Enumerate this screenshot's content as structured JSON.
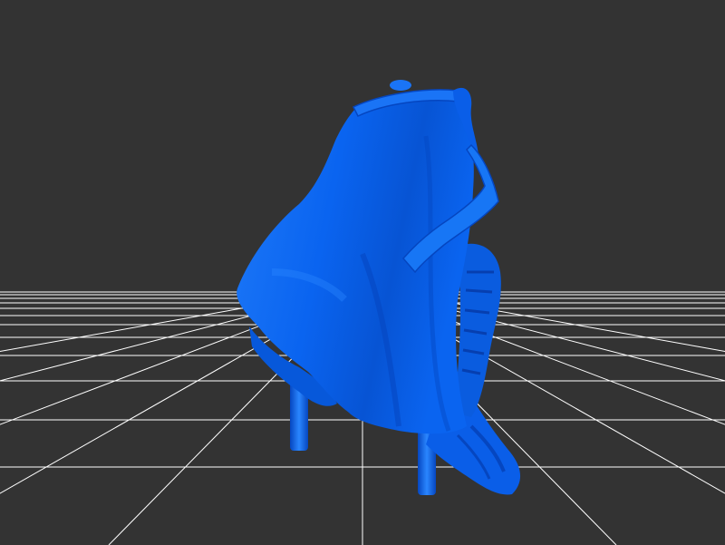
{
  "viewer": {
    "background_color": "#333333",
    "grid_color": "#ffffff",
    "model_color": "#0a64f0",
    "model_shadow_color": "#0546c0",
    "model_highlight_color": "#2a86ff",
    "grid_visible": true
  },
  "model": {
    "icon": "cloaked-figure-mesh"
  }
}
